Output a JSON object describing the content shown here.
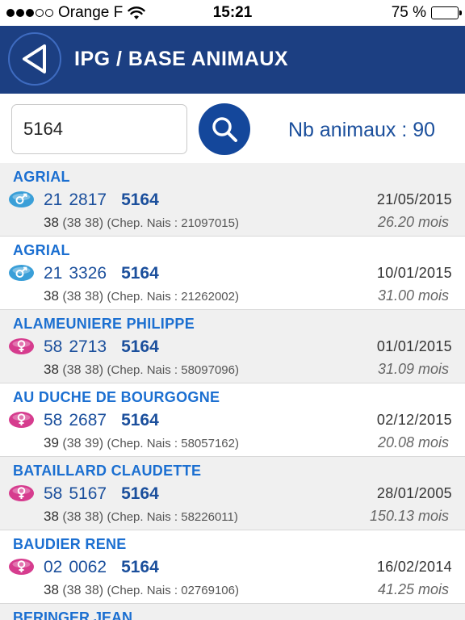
{
  "status_bar": {
    "carrier": "Orange F",
    "time": "15:21",
    "battery": "75 %",
    "battery_level": 0.75
  },
  "header": {
    "title": "IPG / BASE ANIMAUX",
    "back_icon": "back-arrow-icon",
    "color": "#1c3f82"
  },
  "search": {
    "value": "5164",
    "placeholder": "",
    "icon": "search-icon",
    "count_label": "Nb animaux : 90"
  },
  "colors": {
    "owner": "#1b6fd1",
    "number": "#1b4f9c",
    "male": "#3a9fd8",
    "female": "#d63c8e"
  },
  "animals": [
    {
      "owner": "AGRIAL",
      "sex": "male",
      "prefix": "21",
      "mid": "2817",
      "key": "5164",
      "date": "21/05/2015",
      "lead": "38",
      "paren": "(38 38)",
      "chep": "(Chep. Nais : 21097015)",
      "age": "26.20 mois"
    },
    {
      "owner": "AGRIAL",
      "sex": "male",
      "prefix": "21",
      "mid": "3326",
      "key": "5164",
      "date": "10/01/2015",
      "lead": "38",
      "paren": "(38 38)",
      "chep": "(Chep. Nais : 21262002)",
      "age": "31.00 mois"
    },
    {
      "owner": "ALAMEUNIERE PHILIPPE",
      "sex": "female",
      "prefix": "58",
      "mid": "2713",
      "key": "5164",
      "date": "01/01/2015",
      "lead": "38",
      "paren": "(38 38)",
      "chep": "(Chep. Nais : 58097096)",
      "age": "31.09 mois"
    },
    {
      "owner": "AU DUCHE DE BOURGOGNE",
      "sex": "female",
      "prefix": "58",
      "mid": "2687",
      "key": "5164",
      "date": "02/12/2015",
      "lead": "39",
      "paren": "(38 39)",
      "chep": "(Chep. Nais : 58057162)",
      "age": "20.08 mois"
    },
    {
      "owner": "BATAILLARD CLAUDETTE",
      "sex": "female",
      "prefix": "58",
      "mid": "5167",
      "key": "5164",
      "date": "28/01/2005",
      "lead": "38",
      "paren": "(38 38)",
      "chep": "(Chep. Nais : 58226011)",
      "age": "150.13 mois"
    },
    {
      "owner": "BAUDIER RENE",
      "sex": "female",
      "prefix": "02",
      "mid": "0062",
      "key": "5164",
      "date": "16/02/2014",
      "lead": "38",
      "paren": "(38 38)",
      "chep": "(Chep. Nais : 02769106)",
      "age": "41.25 mois"
    }
  ],
  "partial_row": {
    "owner": "BERINGER JEAN"
  }
}
